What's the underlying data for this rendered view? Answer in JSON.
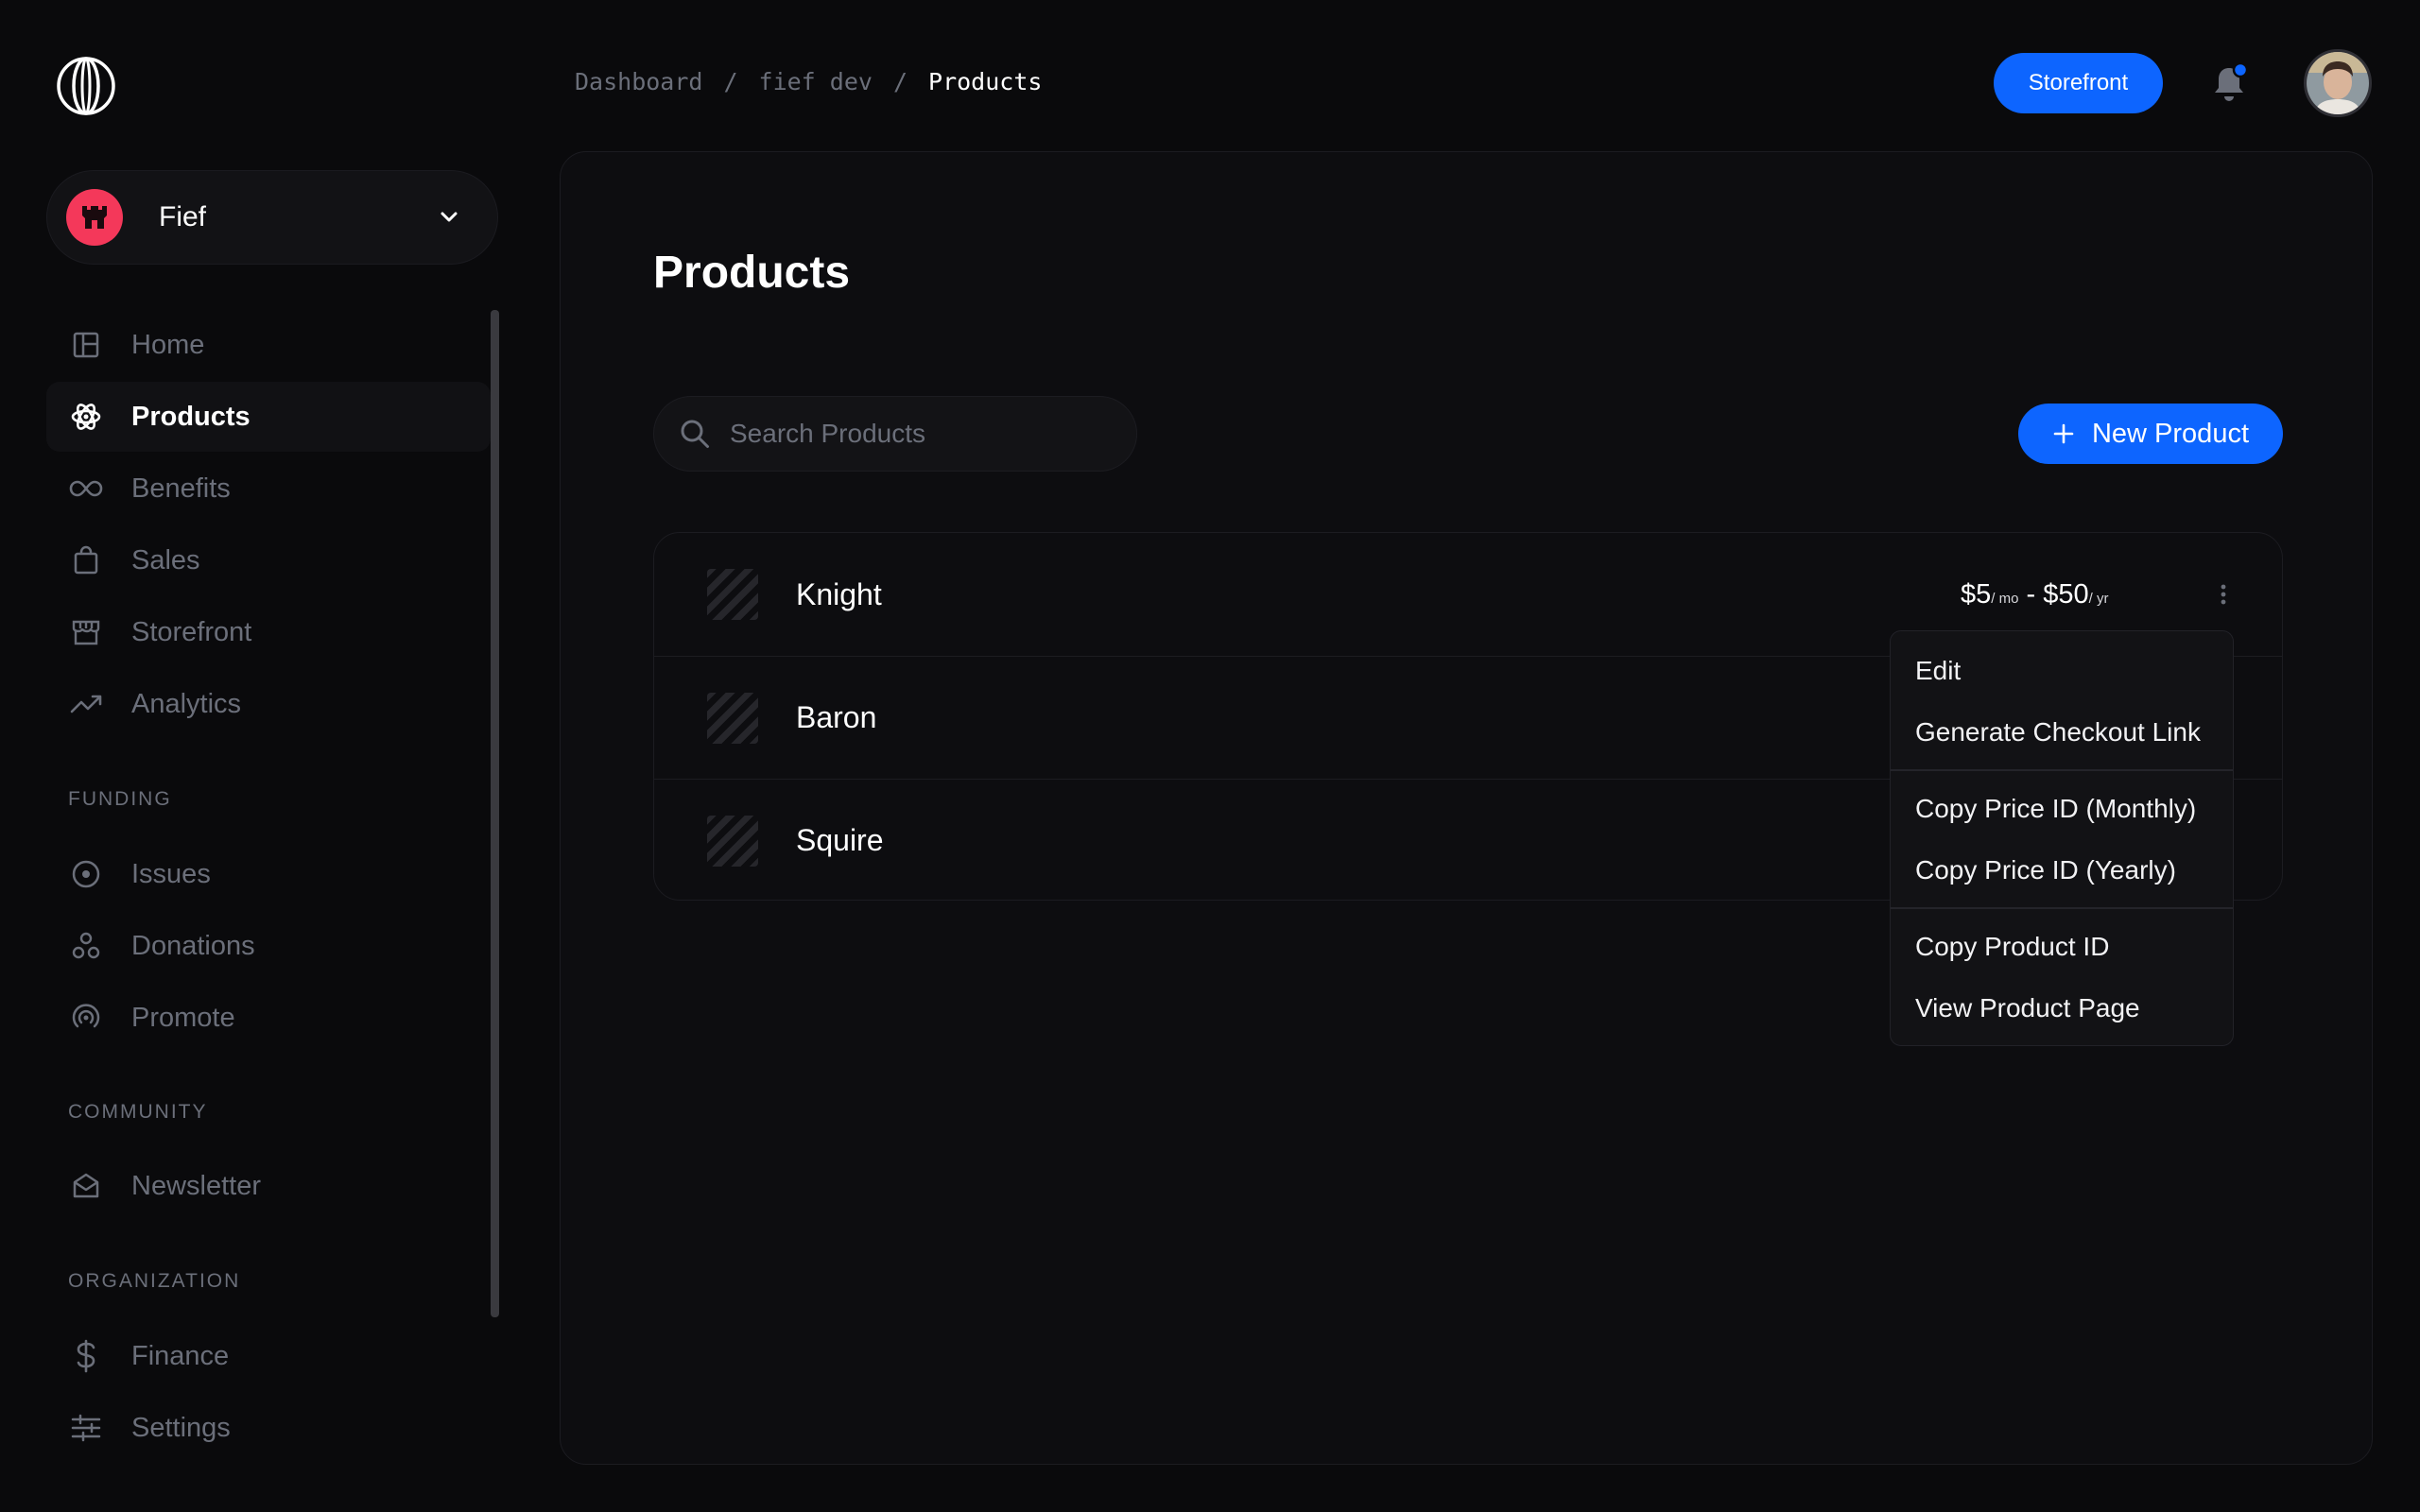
{
  "org": {
    "name": "Fief"
  },
  "nav": {
    "main": [
      {
        "label": "Home",
        "icon": "layout-icon"
      },
      {
        "label": "Products",
        "icon": "hexagon-icon",
        "active": true
      },
      {
        "label": "Benefits",
        "icon": "infinity-icon"
      },
      {
        "label": "Sales",
        "icon": "shopping-bag-icon"
      },
      {
        "label": "Storefront",
        "icon": "store-icon"
      },
      {
        "label": "Analytics",
        "icon": "trending-up-icon"
      }
    ],
    "funding_label": "FUNDING",
    "funding": [
      {
        "label": "Issues",
        "icon": "target-icon"
      },
      {
        "label": "Donations",
        "icon": "people-icon"
      },
      {
        "label": "Promote",
        "icon": "broadcast-icon"
      }
    ],
    "community_label": "COMMUNITY",
    "community": [
      {
        "label": "Newsletter",
        "icon": "mail-open-icon"
      }
    ],
    "organization_label": "ORGANIZATION",
    "organization": [
      {
        "label": "Finance",
        "icon": "dollar-icon"
      },
      {
        "label": "Settings",
        "icon": "sliders-icon"
      }
    ]
  },
  "breadcrumb": {
    "items": [
      "Dashboard",
      "fief dev",
      "Products"
    ],
    "separator": "/"
  },
  "header": {
    "storefront_label": "Storefront"
  },
  "page": {
    "title": "Products",
    "search_placeholder": "Search Products",
    "new_button": "New Product"
  },
  "products": [
    {
      "name": "Knight",
      "price_monthly": "$5",
      "monthly_unit": "/ mo",
      "price_sep": " - ",
      "price_yearly": "$50",
      "yearly_unit": "/ yr"
    },
    {
      "name": "Baron"
    },
    {
      "name": "Squire"
    }
  ],
  "menu": {
    "items": [
      "Edit",
      "Generate Checkout Link",
      "Copy Price ID (Monthly)",
      "Copy Price ID (Yearly)",
      "Copy Product ID",
      "View Product Page"
    ]
  },
  "colors": {
    "accent": "#0d65ff",
    "org_avatar": "#f4385a",
    "background": "#0a0a0c",
    "muted_text": "#6b6f7a"
  }
}
